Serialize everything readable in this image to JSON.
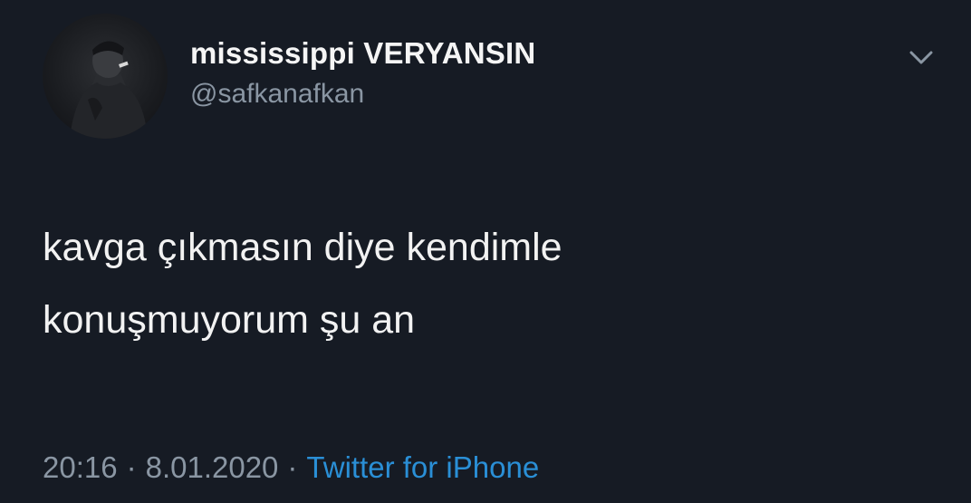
{
  "tweet": {
    "display_name": "mississippi VERYANSIN",
    "username": "@safkanafkan",
    "text_lines": [
      "kavga çıkmasın diye kendimle",
      "konuşmuyorum şu an"
    ],
    "time": "20:16",
    "date": "8.01.2020",
    "separator": "·",
    "source": "Twitter for iPhone"
  },
  "icons": {
    "avatar": "profile-photo",
    "menu": "chevron-down-icon"
  },
  "colors": {
    "background": "#161b24",
    "name": "#f5f5f5",
    "secondary": "#8a96a3",
    "link": "#2a8fd6"
  }
}
